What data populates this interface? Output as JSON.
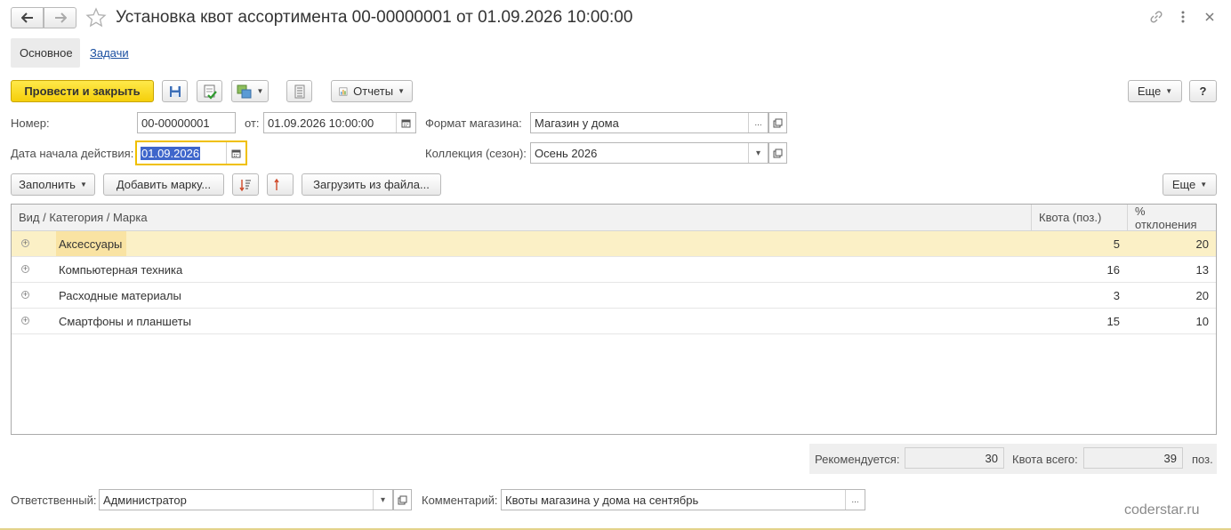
{
  "window": {
    "title": "Установка квот ассортимента 00-00000001 от 01.09.2026 10:00:00"
  },
  "tabs": [
    {
      "label": "Основное",
      "active": true
    },
    {
      "label": "Задачи",
      "active": false
    }
  ],
  "toolbar": {
    "post_close_label": "Провести и закрыть",
    "reports_label": "Отчеты",
    "more_label": "Еще",
    "help_label": "?"
  },
  "form": {
    "number_label": "Номер:",
    "number_value": "00-00000001",
    "from_label": "от:",
    "from_value": "01.09.2026 10:00:00",
    "store_format_label": "Формат магазина:",
    "store_format_value": "Магазин у дома",
    "start_date_label": "Дата начала действия:",
    "start_date_value": "01.09.2026",
    "collection_label": "Коллекция (сезон):",
    "collection_value": "Осень 2026"
  },
  "table_toolbar": {
    "fill_label": "Заполнить",
    "add_brand_label": "Добавить марку...",
    "load_file_label": "Загрузить из файла...",
    "more_label": "Еще"
  },
  "table": {
    "columns": [
      "Вид / Категория / Марка",
      "Квота (поз.)",
      "% отклонения"
    ],
    "rows": [
      {
        "name": "Аксессуары",
        "quota": "5",
        "deviation": "20"
      },
      {
        "name": "Компьютерная техника",
        "quota": "16",
        "deviation": "13"
      },
      {
        "name": "Расходные материалы",
        "quota": "3",
        "deviation": "20"
      },
      {
        "name": "Смартфоны и планшеты",
        "quota": "15",
        "deviation": "10"
      }
    ]
  },
  "totals": {
    "recommended_label": "Рекомендуется:",
    "recommended_value": "30",
    "total_label": "Квота всего:",
    "total_value": "39",
    "unit": "поз."
  },
  "footer": {
    "responsible_label": "Ответственный:",
    "responsible_value": "Администратор",
    "comment_label": "Комментарий:",
    "comment_value": "Квоты магазина у дома на сентябрь"
  },
  "watermark": "coderstar.ru",
  "colors": {
    "primary_button": "#f5cf0a",
    "selected_row": "#fbf0c6",
    "focus_border": "#f0c000",
    "selection_highlight": "#3e66cb"
  }
}
